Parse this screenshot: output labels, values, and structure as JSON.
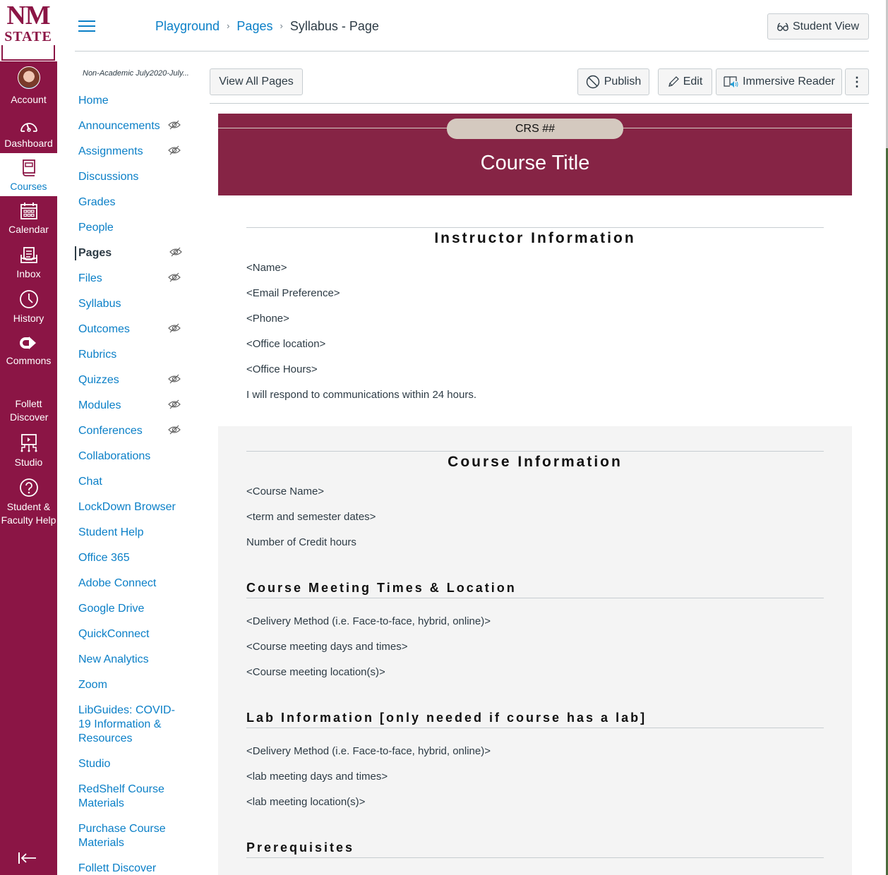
{
  "global_nav": {
    "logo_line1": "NM",
    "logo_line2": "STATE",
    "items": [
      {
        "label": "Account",
        "icon": "avatar"
      },
      {
        "label": "Dashboard",
        "icon": "dashboard-icon"
      },
      {
        "label": "Courses",
        "icon": "courses-icon",
        "active": true
      },
      {
        "label": "Calendar",
        "icon": "calendar-icon"
      },
      {
        "label": "Inbox",
        "icon": "inbox-icon"
      },
      {
        "label": "History",
        "icon": "history-icon"
      },
      {
        "label": "Commons",
        "icon": "commons-icon"
      },
      {
        "label": "Follett Discover",
        "icon": null
      },
      {
        "label": "Studio",
        "icon": "studio-icon"
      },
      {
        "label": "Student & Faculty Help",
        "icon": "help-icon"
      }
    ],
    "collapse_icon": "collapse-nav-icon"
  },
  "header": {
    "breadcrumb": [
      "Playground",
      "Pages",
      "Syllabus - Page"
    ],
    "breadcrumb_sep": "›",
    "student_view_label": "Student View"
  },
  "course_nav": {
    "term": "Non-Academic July2020-July...",
    "items": [
      {
        "label": "Home",
        "hidden": false
      },
      {
        "label": "Announcements",
        "hidden": true
      },
      {
        "label": "Assignments",
        "hidden": true
      },
      {
        "label": "Discussions",
        "hidden": false
      },
      {
        "label": "Grades",
        "hidden": false
      },
      {
        "label": "People",
        "hidden": false
      },
      {
        "label": "Pages",
        "hidden": true,
        "active": true
      },
      {
        "label": "Files",
        "hidden": true
      },
      {
        "label": "Syllabus",
        "hidden": false
      },
      {
        "label": "Outcomes",
        "hidden": true
      },
      {
        "label": "Rubrics",
        "hidden": false
      },
      {
        "label": "Quizzes",
        "hidden": true
      },
      {
        "label": "Modules",
        "hidden": true
      },
      {
        "label": "Conferences",
        "hidden": true
      },
      {
        "label": "Collaborations",
        "hidden": false
      },
      {
        "label": "Chat",
        "hidden": false
      },
      {
        "label": "LockDown Browser",
        "hidden": false
      },
      {
        "label": "Student Help",
        "hidden": false
      },
      {
        "label": "Office 365",
        "hidden": false
      },
      {
        "label": "Adobe Connect",
        "hidden": false
      },
      {
        "label": "Google Drive",
        "hidden": false
      },
      {
        "label": "QuickConnect",
        "hidden": false
      },
      {
        "label": "New Analytics",
        "hidden": false
      },
      {
        "label": "Zoom",
        "hidden": false
      },
      {
        "label": "LibGuides: COVID-19 Information & Resources",
        "hidden": false
      },
      {
        "label": "Studio",
        "hidden": false
      },
      {
        "label": "RedShelf Course Materials",
        "hidden": false
      },
      {
        "label": "Purchase Course Materials",
        "hidden": false
      },
      {
        "label": "Follett Discover",
        "hidden": false
      }
    ]
  },
  "toolbar": {
    "view_all_label": "View All Pages",
    "publish_label": "Publish",
    "edit_label": "Edit",
    "immersive_label": "Immersive Reader",
    "more_label": "⋮"
  },
  "page": {
    "banner": {
      "course_code": "CRS ##",
      "course_title": "Course Title"
    },
    "instructor": {
      "heading": "Instructor Information",
      "lines": [
        "<Name>",
        "<Email Preference>",
        "<Phone>",
        "<Office location>",
        "<Office Hours>",
        "I will respond to communications within 24 hours."
      ]
    },
    "course_info": {
      "heading": "Course Information",
      "lines": [
        "<Course Name>",
        "<term and semester dates>",
        "Number of Credit hours"
      ]
    },
    "meeting": {
      "heading": "Course Meeting Times & Location",
      "lines": [
        "<Delivery Method (i.e. Face-to-face, hybrid, online)>",
        "<Course meeting days and times>",
        "<Course meeting location(s)>"
      ]
    },
    "lab": {
      "heading": "Lab Information [only needed if course has a lab]",
      "lines": [
        "<Delivery Method (i.e. Face-to-face, hybrid, online)>",
        "<lab meeting days and times>",
        "<lab meeting location(s)>"
      ]
    },
    "prereq": {
      "heading": "Prerequisites"
    }
  },
  "colors": {
    "brand": "#8b1545",
    "banner": "#862445",
    "link": "#0a7fc7",
    "pill": "#d4c9bf"
  }
}
